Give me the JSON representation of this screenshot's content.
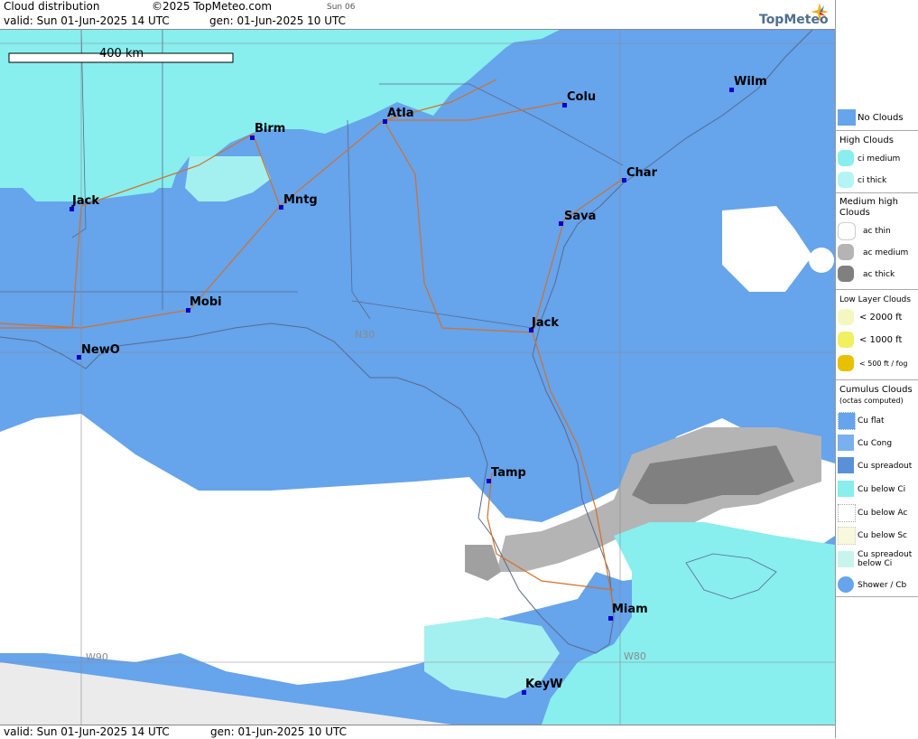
{
  "header": {
    "title": "Cloud distribution",
    "copyright": "©2025 TopMeteo.com",
    "day_code": "Sun 06",
    "valid": "valid:  Sun  01-Jun-2025  14 UTC",
    "generated": "gen:  01-Jun-2025 10 UTC",
    "brand": "TopMeteo"
  },
  "footer": {
    "valid": "valid:  Sun  01-Jun-2025  14 UTC",
    "generated": "gen:  01-Jun-2025 10 UTC"
  },
  "map": {
    "scale_label": "400 km",
    "grid_labels": [
      "N30",
      "W90",
      "W80"
    ],
    "cities": [
      {
        "name": "Wilm"
      },
      {
        "name": "Colu"
      },
      {
        "name": "Atla"
      },
      {
        "name": "Birm"
      },
      {
        "name": "Char"
      },
      {
        "name": "Sava"
      },
      {
        "name": "Jack"
      },
      {
        "name": "Mntg"
      },
      {
        "name": "Mobi"
      },
      {
        "name": "Jack"
      },
      {
        "name": "NewO"
      },
      {
        "name": "Tamp"
      },
      {
        "name": "Miam"
      },
      {
        "name": "KeyW"
      }
    ]
  },
  "legend": {
    "no_clouds": "No Clouds",
    "high_header": "High Clouds",
    "ci_medium": "ci medium",
    "ci_thick": "ci thick",
    "medium_header": "Medium high Clouds",
    "ac_thin": "ac thin",
    "ac_medium": "ac medium",
    "ac_thick": "ac thick",
    "low_header": "Low Layer Clouds",
    "low_2000": "< 2000 ft",
    "low_1000": "< 1000 ft",
    "low_500": "< 500 ft / fog",
    "cu_header": "Cumulus Clouds",
    "cu_sub": "(octas computed)",
    "cu_flat": "Cu flat",
    "cu_cong": "Cu Cong",
    "cu_spread": "Cu spreadout",
    "cu_below_ci": "Cu below Ci",
    "cu_below_ac": "Cu below Ac",
    "cu_below_sc": "Cu below Sc",
    "cu_spread_ci": "Cu spreadout below Ci",
    "shower": "Shower / Cb"
  },
  "colors": {
    "no_clouds": "#66a4ec",
    "ci_medium": "#88eeee",
    "ci_thick": "#b4f4f4",
    "ac_thin": "#ffffff",
    "ac_medium": "#b4b4b4",
    "ac_thick": "#808080",
    "low_2000": "#f4f8c0",
    "low_1000": "#f0f060",
    "low_500": "#e8c000",
    "outline": "#5a6a8a",
    "roads": "#d2702a",
    "city_marker": "#0000cc"
  }
}
